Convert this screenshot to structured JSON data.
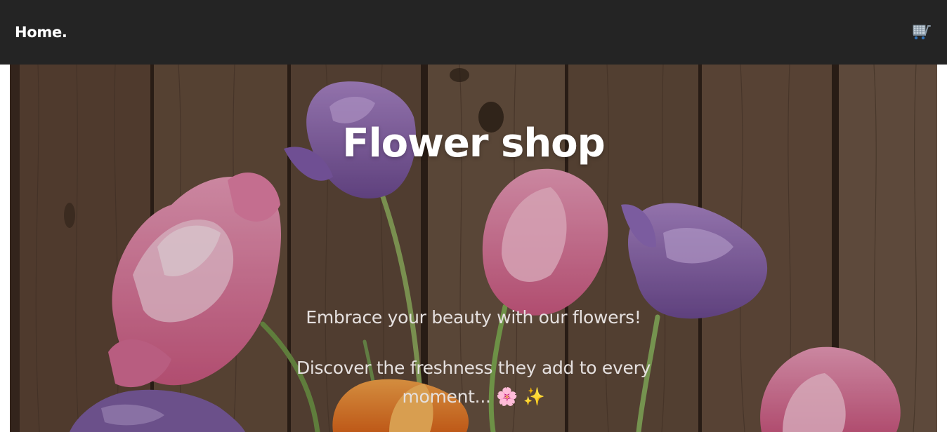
{
  "navbar": {
    "brand": "Home.",
    "cart_icon": "shopping-cart-icon"
  },
  "hero": {
    "title": "Flower shop",
    "tagline": "Embrace your beauty with our flowers!",
    "discover": "Discover the freshness they add to every moment... 🌸 ✨",
    "background": "wooden planks with tulips"
  },
  "colors": {
    "navbar_bg": "#242424",
    "hero_title": "#ffffff",
    "hero_text": "#e5e0df"
  }
}
